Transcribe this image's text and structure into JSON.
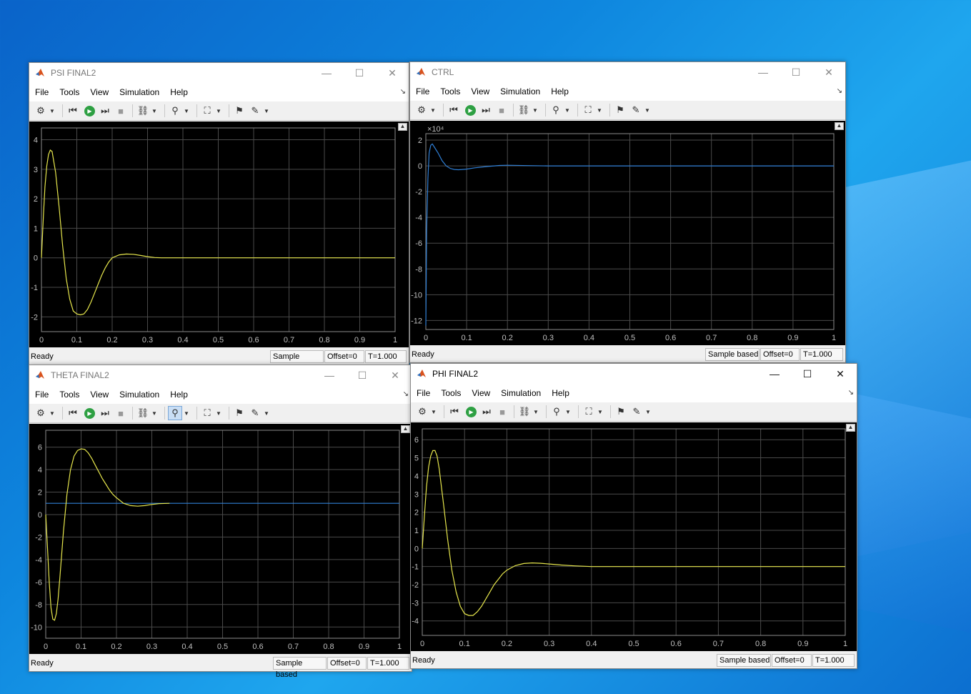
{
  "menu": [
    "File",
    "Tools",
    "View",
    "Simulation",
    "Help"
  ],
  "status": {
    "ready": "Ready",
    "sample": "Sample based",
    "offset": "Offset=0",
    "time": "T=1.000"
  },
  "windows": [
    {
      "title": "PSI FINAL2",
      "chart_data": {
        "type": "line",
        "xlim": [
          0,
          1
        ],
        "ylim": [
          -2.5,
          4.4
        ],
        "x_ticks": [
          0,
          0.1,
          0.2,
          0.3,
          0.4,
          0.5,
          0.6,
          0.7,
          0.8,
          0.9,
          1
        ],
        "y_ticks": [
          -2,
          -1,
          0,
          1,
          2,
          3,
          4
        ],
        "series": [
          {
            "color": "#e6e64c",
            "x": [
              0,
              0.005,
              0.01,
              0.015,
              0.02,
              0.025,
              0.03,
              0.04,
              0.05,
              0.06,
              0.07,
              0.08,
              0.09,
              0.1,
              0.11,
              0.12,
              0.13,
              0.14,
              0.15,
              0.16,
              0.17,
              0.18,
              0.19,
              0.2,
              0.22,
              0.24,
              0.26,
              0.28,
              0.3,
              0.32,
              0.34,
              0.36,
              0.4,
              0.5,
              0.6,
              0.7,
              0.8,
              0.9,
              1
            ],
            "y": [
              0,
              1.3,
              2.4,
              3.1,
              3.5,
              3.65,
              3.6,
              2.9,
              1.7,
              0.4,
              -0.7,
              -1.4,
              -1.8,
              -1.9,
              -1.93,
              -1.9,
              -1.75,
              -1.5,
              -1.2,
              -0.9,
              -0.6,
              -0.35,
              -0.15,
              0,
              0.1,
              0.13,
              0.12,
              0.08,
              0.04,
              0.01,
              0,
              0,
              0,
              0,
              0,
              0,
              0,
              0,
              0
            ]
          }
        ]
      }
    },
    {
      "title": "CTRL",
      "chart_data": {
        "type": "line",
        "xlim": [
          0,
          1
        ],
        "ylim": [
          -12.7,
          2.5
        ],
        "x_ticks": [
          0,
          0.1,
          0.2,
          0.3,
          0.4,
          0.5,
          0.6,
          0.7,
          0.8,
          0.9,
          1
        ],
        "y_ticks": [
          -12,
          -10,
          -8,
          -6,
          -4,
          -2,
          0,
          2
        ],
        "y_exponent": "×10⁴",
        "series": [
          {
            "color": "#2f7fd6",
            "x": [
              0,
              0.002,
              0.005,
              0.008,
              0.012,
              0.016,
              0.02,
              0.03,
              0.04,
              0.05,
              0.06,
              0.07,
              0.08,
              0.1,
              0.12,
              0.15,
              0.18,
              0.2,
              0.25,
              0.3,
              0.5,
              1
            ],
            "y": [
              -12.4,
              -5,
              -1,
              1,
              1.6,
              1.7,
              1.5,
              1.0,
              0.4,
              0,
              -0.2,
              -0.28,
              -0.3,
              -0.25,
              -0.15,
              -0.05,
              0.03,
              0.05,
              0.02,
              0,
              0,
              0
            ]
          }
        ]
      }
    },
    {
      "title": "THETA FINAL2",
      "chart_data": {
        "type": "line",
        "xlim": [
          0,
          1
        ],
        "ylim": [
          -11,
          7.5
        ],
        "x_ticks": [
          0,
          0.1,
          0.2,
          0.3,
          0.4,
          0.5,
          0.6,
          0.7,
          0.8,
          0.9,
          1
        ],
        "y_ticks": [
          -10,
          -8,
          -6,
          -4,
          -2,
          0,
          2,
          4,
          6
        ],
        "series": [
          {
            "color": "#2f7fd6",
            "x": [
              0,
              1
            ],
            "y": [
              1,
              1
            ]
          },
          {
            "color": "#e6e64c",
            "x": [
              0,
              0.005,
              0.01,
              0.015,
              0.02,
              0.025,
              0.03,
              0.035,
              0.04,
              0.05,
              0.06,
              0.07,
              0.08,
              0.09,
              0.1,
              0.11,
              0.12,
              0.13,
              0.14,
              0.15,
              0.16,
              0.17,
              0.18,
              0.19,
              0.2,
              0.22,
              0.24,
              0.26,
              0.28,
              0.3,
              0.32,
              0.35
            ],
            "y": [
              0,
              -3,
              -6,
              -8.3,
              -9.3,
              -9.4,
              -8.8,
              -7.5,
              -5.6,
              -1.5,
              1.8,
              4,
              5.2,
              5.7,
              5.85,
              5.8,
              5.5,
              5,
              4.4,
              3.8,
              3.2,
              2.7,
              2.2,
              1.8,
              1.5,
              1.0,
              0.8,
              0.75,
              0.8,
              0.9,
              0.97,
              1
            ]
          }
        ]
      }
    },
    {
      "title": "PHI FINAL2",
      "chart_data": {
        "type": "line",
        "xlim": [
          0,
          1
        ],
        "ylim": [
          -4.8,
          6.6
        ],
        "x_ticks": [
          0,
          0.1,
          0.2,
          0.3,
          0.4,
          0.5,
          0.6,
          0.7,
          0.8,
          0.9,
          1
        ],
        "y_ticks": [
          -4,
          -3,
          -2,
          -1,
          0,
          1,
          2,
          3,
          4,
          5,
          6
        ],
        "series": [
          {
            "color": "#e6e64c",
            "x": [
              0,
              0.005,
              0.01,
              0.015,
              0.02,
              0.025,
              0.03,
              0.035,
              0.04,
              0.05,
              0.06,
              0.07,
              0.08,
              0.09,
              0.1,
              0.11,
              0.12,
              0.13,
              0.14,
              0.15,
              0.16,
              0.17,
              0.18,
              0.19,
              0.2,
              0.22,
              0.24,
              0.26,
              0.28,
              0.3,
              0.33,
              0.36,
              0.4,
              0.5,
              0.6,
              0.7,
              0.8,
              0.9,
              1
            ],
            "y": [
              0,
              1.8,
              3.4,
              4.5,
              5.1,
              5.4,
              5.4,
              5.1,
              4.4,
              2.5,
              0.5,
              -1.2,
              -2.4,
              -3.2,
              -3.6,
              -3.7,
              -3.7,
              -3.5,
              -3.2,
              -2.8,
              -2.4,
              -2.0,
              -1.7,
              -1.4,
              -1.2,
              -0.95,
              -0.83,
              -0.8,
              -0.82,
              -0.86,
              -0.92,
              -0.96,
              -1,
              -1,
              -1,
              -1,
              -1,
              -1,
              -1
            ]
          }
        ]
      }
    }
  ]
}
